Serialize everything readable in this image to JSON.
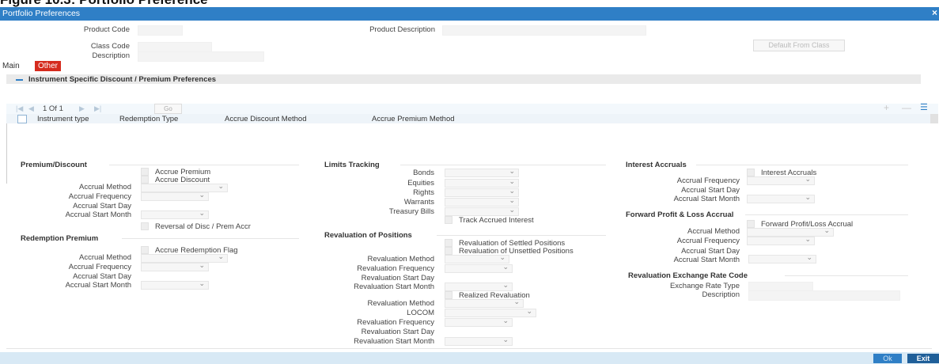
{
  "caption": "Figure 10.3: Portfolio Preference",
  "window": {
    "title": "Portfolio Preferences",
    "close_glyph": "×"
  },
  "header": {
    "product_code_label": "Product Code",
    "product_description_label": "Product Description",
    "class_code_label": "Class Code",
    "description_label": "Description",
    "default_from_class": "Default From Class"
  },
  "tabs": {
    "main": "Main",
    "other": "Other"
  },
  "instrument": {
    "section_title": "Instrument Specific Discount / Premium Preferences",
    "pagination": "1 Of 1",
    "go": "Go",
    "columns": [
      "Instrument type",
      "Redemption Type",
      "Accrue Discount Method",
      "Accrue Premium Method"
    ]
  },
  "premium_discount": {
    "title": "Premium/Discount",
    "accrue_premium": "Accrue Premium",
    "accrue_discount": "Accrue Discount",
    "accrual_method": "Accrual Method",
    "accrual_frequency": "Accrual Frequency",
    "accrual_start_day": "Accrual Start Day",
    "accrual_start_month": "Accrual Start Month",
    "reversal": "Reversal of Disc / Prem Accr"
  },
  "redemption_premium": {
    "title": "Redemption Premium",
    "accrue_redemption_flag": "Accrue Redemption Flag",
    "accrual_method": "Accrual Method",
    "accrual_frequency": "Accrual Frequency",
    "accrual_start_day": "Accrual Start Day",
    "accrual_start_month": "Accrual Start Month"
  },
  "limits_tracking": {
    "title": "Limits Tracking",
    "bonds": "Bonds",
    "equities": "Equities",
    "rights": "Rights",
    "warrants": "Warrants",
    "treasury_bills": "Treasury Bills",
    "track_accrued_interest": "Track Accrued Interest"
  },
  "revaluation": {
    "title": "Revaluation of Positions",
    "settled": "Revaluation of Settled Positions",
    "unsettled": "Revaluation of Unsettled Positions",
    "method": "Revaluation Method",
    "frequency": "Revaluation Frequency",
    "start_day": "Revaluation Start Day",
    "start_month": "Revaluation Start Month",
    "realized": "Realized Revaluation",
    "method2": "Revaluation Method",
    "locom": "LOCOM",
    "frequency2": "Revaluation Frequency",
    "start_day2": "Revaluation Start Day",
    "start_month2": "Revaluation Start Month"
  },
  "interest_accruals": {
    "title": "Interest Accruals",
    "checkbox": "Interest Accruals",
    "frequency": "Accrual Frequency",
    "start_day": "Accrual Start Day",
    "start_month": "Accrual Start Month"
  },
  "fwd_pnl": {
    "title": "Forward Profit & Loss Accrual",
    "checkbox": "Forward Profit/Loss Accrual",
    "method": "Accrual Method",
    "frequency": "Accrual Frequency",
    "start_day": "Accrual Start Day",
    "start_month": "Accrual Start Month"
  },
  "exchange_rate": {
    "title": "Revaluation Exchange Rate Code",
    "type": "Exchange Rate Type",
    "description": "Description"
  },
  "footer": {
    "ok": "Ok",
    "exit": "Exit"
  },
  "colors": {
    "title_bar": "#2f7fc6",
    "tab_active": "#d52b1e",
    "footer": "#d8e9f5"
  }
}
